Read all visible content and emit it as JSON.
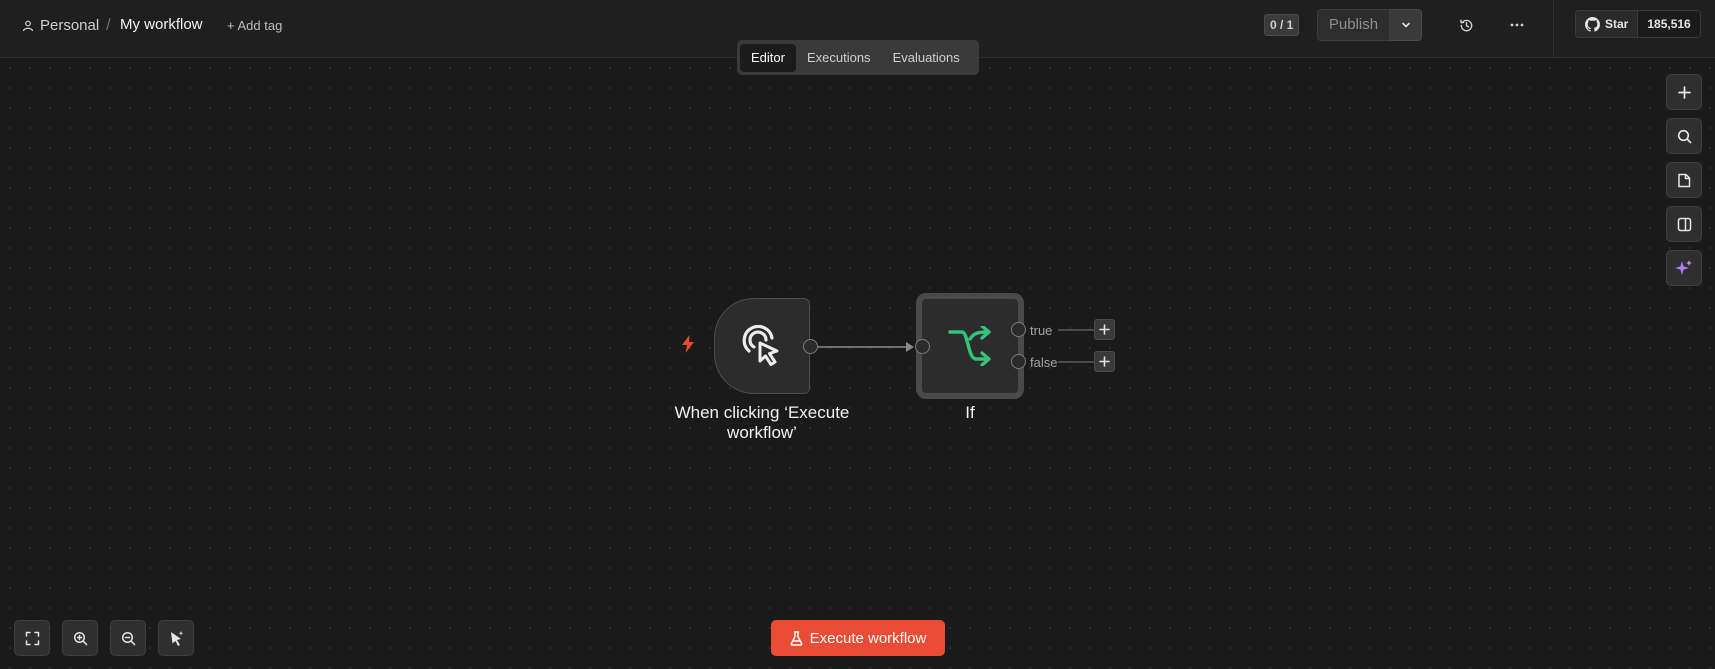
{
  "header": {
    "breadcrumb_personal": "Personal",
    "breadcrumb_sep": "/",
    "workflow_title": "My workflow",
    "add_tag": "+ Add tag",
    "counter": "0 / 1",
    "publish_label": "Publish",
    "github_star": "Star",
    "github_count": "185,516"
  },
  "tabs": [
    {
      "label": "Editor",
      "active": true
    },
    {
      "label": "Executions",
      "active": false
    },
    {
      "label": "Evaluations",
      "active": false
    }
  ],
  "nodes": {
    "trigger": {
      "label": "When clicking ‘Execute workflow’",
      "icon": "cursor-click-icon"
    },
    "if": {
      "label": "If",
      "icon": "branch-icon",
      "outputs": [
        "true",
        "false"
      ]
    }
  },
  "right_toolbar": [
    "add-node-icon",
    "search-icon",
    "sticky-note-icon",
    "panel-icon",
    "ai-sparkle-icon"
  ],
  "bottom_controls": [
    "fit-view-icon",
    "zoom-in-icon",
    "zoom-out-icon",
    "tidy-up-icon"
  ],
  "execute_button": "Execute workflow",
  "colors": {
    "accent": "#ea4b35",
    "branch_green": "#35c27a",
    "sparkle_purple": "#b07cf0",
    "bolt_red": "#ea4b35"
  }
}
